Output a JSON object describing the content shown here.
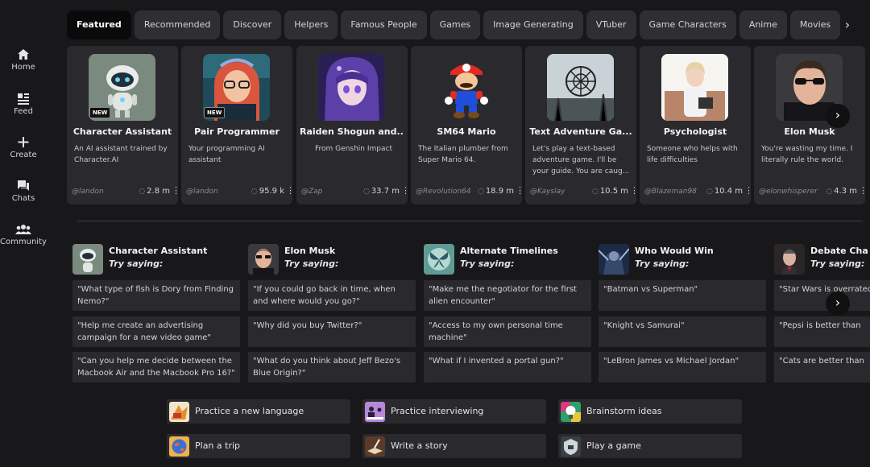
{
  "sidebar": {
    "items": [
      {
        "label": "Home",
        "icon": "home-icon"
      },
      {
        "label": "Feed",
        "icon": "feed-icon"
      },
      {
        "label": "Create",
        "icon": "plus-icon"
      },
      {
        "label": "Chats",
        "icon": "chats-icon"
      },
      {
        "label": "Community",
        "icon": "community-icon"
      }
    ]
  },
  "tabs": [
    "Featured",
    "Recommended",
    "Discover",
    "Helpers",
    "Famous People",
    "Games",
    "Image Generating",
    "VTuber",
    "Game Characters",
    "Anime",
    "Movies"
  ],
  "active_tab": "Featured",
  "featured": [
    {
      "title": "Character Assistant",
      "desc": "An AI assistant trained by Character.AI",
      "author": "@landon",
      "count": "2.8 m",
      "badge": "NEW"
    },
    {
      "title": "Pair Programmer",
      "desc": "Your programming AI assistant",
      "author": "@landon",
      "count": "95.9 k",
      "badge": "NEW"
    },
    {
      "title": "Raiden Shogun and...",
      "desc": "From Genshin Impact",
      "author": "@Zap",
      "count": "33.7 m"
    },
    {
      "title": "SM64 Mario",
      "desc": "The Italian plumber from Super Mario 64.",
      "author": "@Revolution64",
      "count": "18.9 m"
    },
    {
      "title": "Text Adventure Ga...",
      "desc": "Let's play a text-based adventure game. I'll be your guide. You are caug...",
      "author": "@Kayslay",
      "count": "10.5 m"
    },
    {
      "title": "Psychologist",
      "desc": "Someone who helps with life difficulties",
      "author": "@Blazeman98",
      "count": "10.4 m"
    },
    {
      "title": "Elon Musk",
      "desc": "You're wasting my time. I literally rule the world.",
      "author": "@elonwhisperer",
      "count": "4.3 m"
    }
  ],
  "try_saying_label": "Try saying:",
  "suggestions": [
    {
      "name": "Character Assistant",
      "prompts": [
        "\"What type of fish is Dory from Finding Nemo?\"",
        "\"Help me create an advertising campaign for a new video game\"",
        "\"Can you help me decide between the Macbook Air and the Macbook Pro 16?\""
      ]
    },
    {
      "name": "Elon Musk",
      "prompts": [
        "\"If you could go back in time, when and where would you go?\"",
        "\"Why did you buy Twitter?\"",
        "\"What do you think about Jeff Bezo's Blue Origin?\""
      ]
    },
    {
      "name": "Alternate Timelines",
      "prompts": [
        "\"Make me the negotiator for the first alien encounter\"",
        "\"Access to my own personal time machine\"",
        "\"What if I invented a portal gun?\""
      ]
    },
    {
      "name": "Who Would Win",
      "prompts": [
        "\"Batman vs Superman\"",
        "\"Knight vs Samurai\"",
        "\"LeBron James vs Michael Jordan\""
      ]
    },
    {
      "name": "Debate Cha",
      "prompts": [
        "\"Star Wars is overrated",
        "\"Pepsi is better than",
        "\"Cats are better than"
      ]
    }
  ],
  "quick_actions": [
    {
      "label": "Practice a new language",
      "icon": "language-icon"
    },
    {
      "label": "Practice interviewing",
      "icon": "interview-icon"
    },
    {
      "label": "Brainstorm ideas",
      "icon": "lightbulb-icon"
    },
    {
      "label": "Plan a trip",
      "icon": "globe-icon"
    },
    {
      "label": "Write a story",
      "icon": "book-icon"
    },
    {
      "label": "Play a game",
      "icon": "game-icon"
    }
  ],
  "accent": "#0a0a0b"
}
